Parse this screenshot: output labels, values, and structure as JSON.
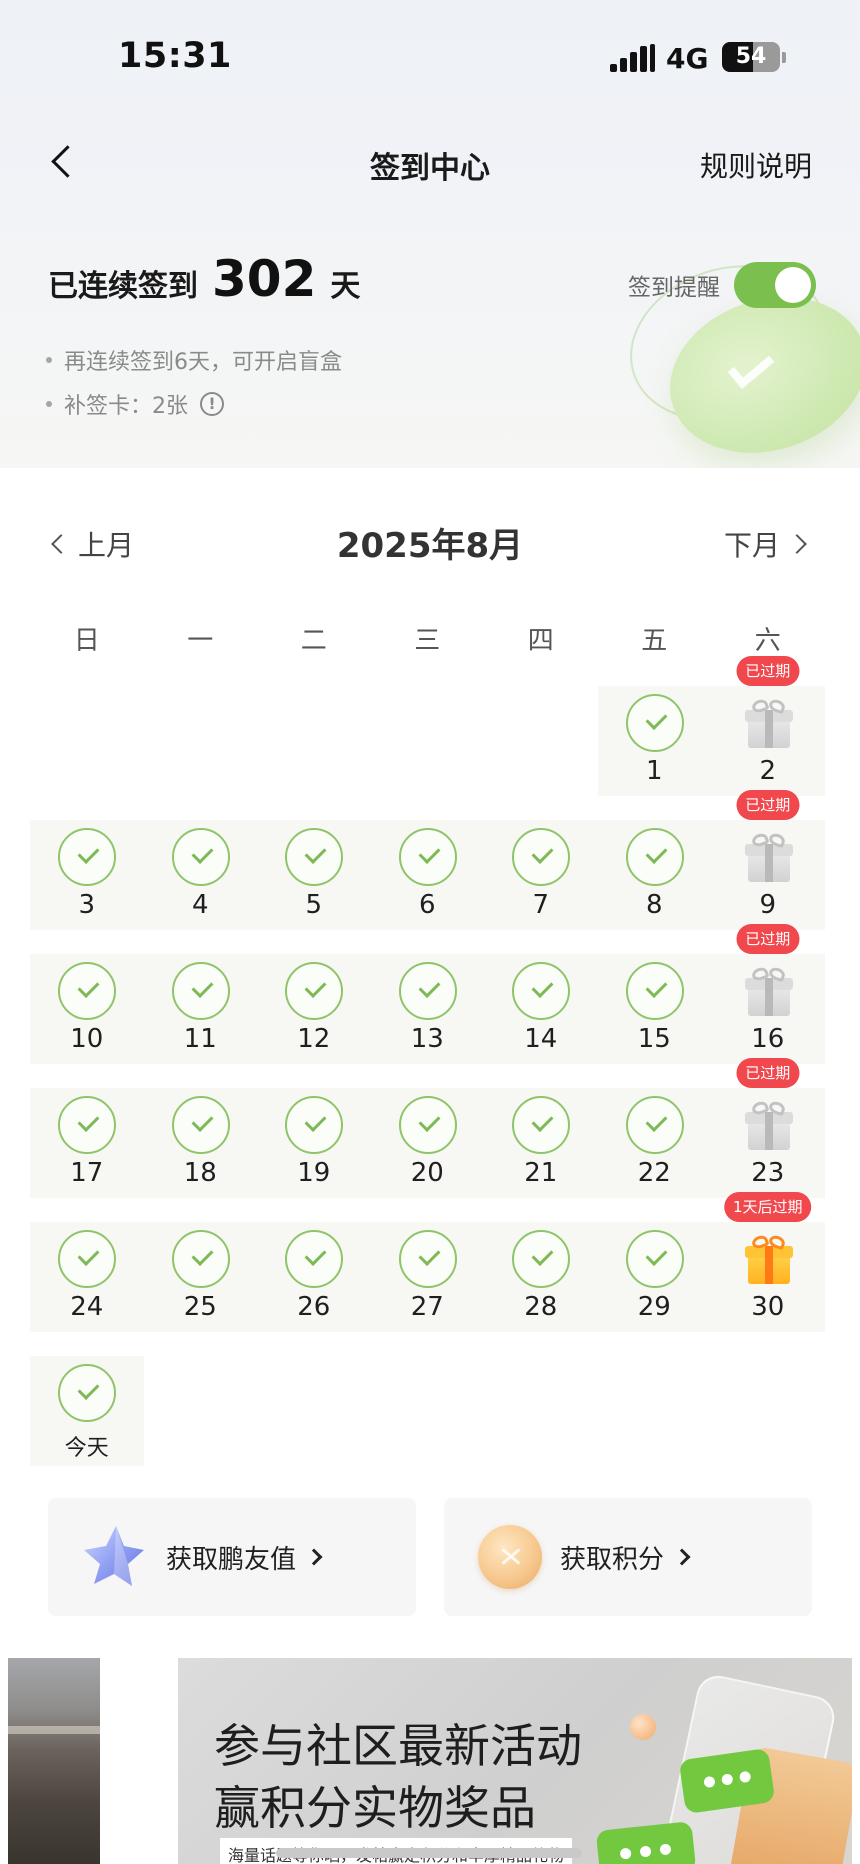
{
  "status_bar": {
    "time": "15:31",
    "network": "4G",
    "battery": "54",
    "battery_level": 0.54
  },
  "nav": {
    "title": "签到中心",
    "rules_label": "规则说明",
    "back_icon": "chevron-left-icon"
  },
  "streak": {
    "prefix": "已连续签到",
    "days": "302",
    "suffix": "天"
  },
  "reminder": {
    "label": "签到提醒",
    "enabled": true,
    "accent": "#7bbf4e"
  },
  "tips": [
    {
      "text": "再连续签到6天，可开启盲盒"
    },
    {
      "text": "补签卡：2张",
      "info_icon": "!"
    }
  ],
  "month_nav": {
    "prev_label": "上月",
    "title": "2025年8月",
    "next_label": "下月"
  },
  "weekdays": [
    "日",
    "一",
    "二",
    "三",
    "四",
    "五",
    "六"
  ],
  "calendar": {
    "days": [
      {
        "label": "1",
        "status": "checked"
      },
      {
        "label": "2",
        "status": "gift-expired",
        "badge": "已过期"
      },
      {
        "label": "3",
        "status": "checked"
      },
      {
        "label": "4",
        "status": "checked"
      },
      {
        "label": "5",
        "status": "checked"
      },
      {
        "label": "6",
        "status": "checked"
      },
      {
        "label": "7",
        "status": "checked"
      },
      {
        "label": "8",
        "status": "checked"
      },
      {
        "label": "9",
        "status": "gift-expired",
        "badge": "已过期"
      },
      {
        "label": "10",
        "status": "checked"
      },
      {
        "label": "11",
        "status": "checked"
      },
      {
        "label": "12",
        "status": "checked"
      },
      {
        "label": "13",
        "status": "checked"
      },
      {
        "label": "14",
        "status": "checked"
      },
      {
        "label": "15",
        "status": "checked"
      },
      {
        "label": "16",
        "status": "gift-expired",
        "badge": "已过期"
      },
      {
        "label": "17",
        "status": "checked"
      },
      {
        "label": "18",
        "status": "checked"
      },
      {
        "label": "19",
        "status": "checked"
      },
      {
        "label": "20",
        "status": "checked"
      },
      {
        "label": "21",
        "status": "checked"
      },
      {
        "label": "22",
        "status": "checked"
      },
      {
        "label": "23",
        "status": "gift-expired",
        "badge": "已过期"
      },
      {
        "label": "24",
        "status": "checked"
      },
      {
        "label": "25",
        "status": "checked"
      },
      {
        "label": "26",
        "status": "checked"
      },
      {
        "label": "27",
        "status": "checked"
      },
      {
        "label": "28",
        "status": "checked"
      },
      {
        "label": "29",
        "status": "checked"
      },
      {
        "label": "30",
        "status": "gift-active",
        "badge": "1天后过期"
      },
      {
        "label": "今天",
        "status": "checked"
      }
    ]
  },
  "cards": {
    "friend_value": {
      "label": "获取鹏友值",
      "icon": "star-crystal-icon"
    },
    "points": {
      "label": "获取积分",
      "icon": "coin-icon"
    }
  },
  "banner": {
    "line1": "参与社区最新活动",
    "line2": "赢积分实物奖品",
    "subtitle": "海量话题等你晒，发帖赢走积分和丰厚精品礼物"
  }
}
